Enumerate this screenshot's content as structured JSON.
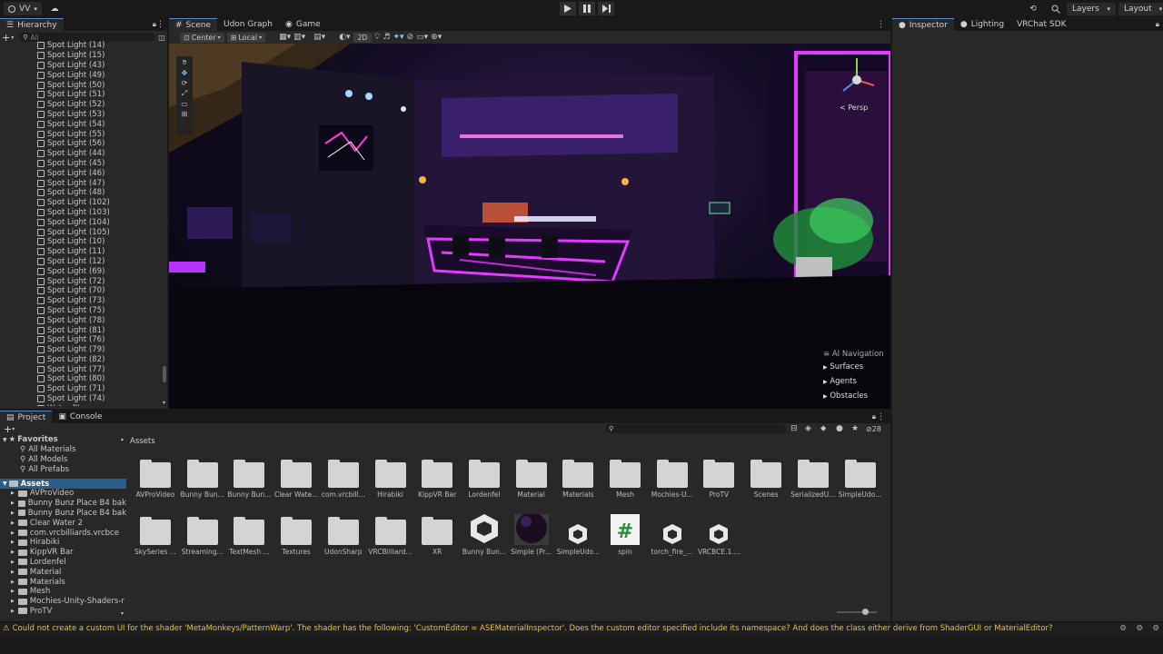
{
  "topbar": {
    "account_label": "VV",
    "layers_label": "Layers",
    "layout_label": "Layout"
  },
  "hierarchy": {
    "tab_label": "Hierarchy",
    "search_placeholder": "All",
    "items": [
      "Spot Light (14)",
      "Spot Light (15)",
      "Spot Light (43)",
      "Spot Light (49)",
      "Spot Light (50)",
      "Spot Light (51)",
      "Spot Light (52)",
      "Spot Light (53)",
      "Spot Light (54)",
      "Spot Light (55)",
      "Spot Light (56)",
      "Spot Light (44)",
      "Spot Light (45)",
      "Spot Light (46)",
      "Spot Light (47)",
      "Spot Light (48)",
      "Spot Light (102)",
      "Spot Light (103)",
      "Spot Light (104)",
      "Spot Light (105)",
      "Spot Light (10)",
      "Spot Light (11)",
      "Spot Light (12)",
      "Spot Light (69)",
      "Spot Light (72)",
      "Spot Light (70)",
      "Spot Light (73)",
      "Spot Light (75)",
      "Spot Light (78)",
      "Spot Light (81)",
      "Spot Light (76)",
      "Spot Light (79)",
      "Spot Light (82)",
      "Spot Light (77)",
      "Spot Light (80)",
      "Spot Light (71)",
      "Spot Light (74)",
      "Water Plane"
    ]
  },
  "scene": {
    "tabs": [
      "Scene",
      "Udon Graph",
      "Game"
    ],
    "pivot_label": "Center",
    "space_label": "Local",
    "mode_2d": "2D",
    "persp_label": "Persp",
    "ai_nav": {
      "title": "AI Navigation",
      "items": [
        "Surfaces",
        "Agents",
        "Obstacles"
      ]
    }
  },
  "inspector": {
    "tabs": [
      "Inspector",
      "Lighting",
      "VRChat SDK"
    ]
  },
  "project": {
    "tabs": [
      "Project",
      "Console"
    ],
    "hidden_count": "28",
    "favorites_label": "Favorites",
    "favorites": [
      "All Materials",
      "All Models",
      "All Prefabs"
    ],
    "assets_root": "Assets",
    "tree": [
      "AVProVideo",
      "Bunny Bunz Place B4 bak",
      "Bunny Bunz Place B4 bak",
      "Clear Water 2",
      "com.vrcbilliards.vrcbce",
      "Hirabiki",
      "KippVR Bar",
      "Lordenfel",
      "Material",
      "Materials",
      "Mesh",
      "Mochies-Unity-Shaders-r",
      "ProTV"
    ],
    "breadcrumb": "Assets",
    "grid_row1": [
      "AVProVideo",
      "Bunny Bun...",
      "Bunny Bun...",
      "Clear Wate...",
      "com.vrcbill...",
      "Hirabiki",
      "KippVR Bar",
      "Lordenfel",
      "Material",
      "Materials",
      "Mesh",
      "Mochies-U...",
      "ProTV",
      "Scenes",
      "SerializedU...",
      "SimpleUdo..."
    ],
    "grid_row2": [
      {
        "label": "SkySeries ...",
        "icon": "folder-icon"
      },
      {
        "label": "Streaming...",
        "icon": "folder-icon"
      },
      {
        "label": "TextMesh ...",
        "icon": "folder-icon"
      },
      {
        "label": "Textures",
        "icon": "folder-icon"
      },
      {
        "label": "UdonSharp",
        "icon": "folder-icon"
      },
      {
        "label": "VRCBilliard...",
        "icon": "folder-icon"
      },
      {
        "label": "XR",
        "icon": "folder-icon"
      },
      {
        "label": "Bunny Bun...",
        "icon": "unity-scene-icon"
      },
      {
        "label": "Simple (Pr...",
        "icon": "material-sphere-icon"
      },
      {
        "label": "SimpleUdo...",
        "icon": "prefab-icon"
      },
      {
        "label": "spin",
        "icon": "csharp-script-icon"
      },
      {
        "label": "torch_fire_...",
        "icon": "prefab-icon"
      },
      {
        "label": "VRCBCE.1....",
        "icon": "prefab-icon"
      }
    ]
  },
  "status": {
    "message": "Could not create a custom UI for the shader 'MetaMonkeys/PatternWarp'. The shader has the following: 'CustomEditor = ASEMaterialInspector'. Does the custom editor specified include its namespace? And does the class either derive from ShaderGUI or MaterialEditor?"
  },
  "colors": {
    "accent": "#5a8cc9",
    "warning": "#e8c23a",
    "selection": "#2c5d87",
    "neon_pink": "#e23bff",
    "neon_purple": "#7d2cff"
  }
}
